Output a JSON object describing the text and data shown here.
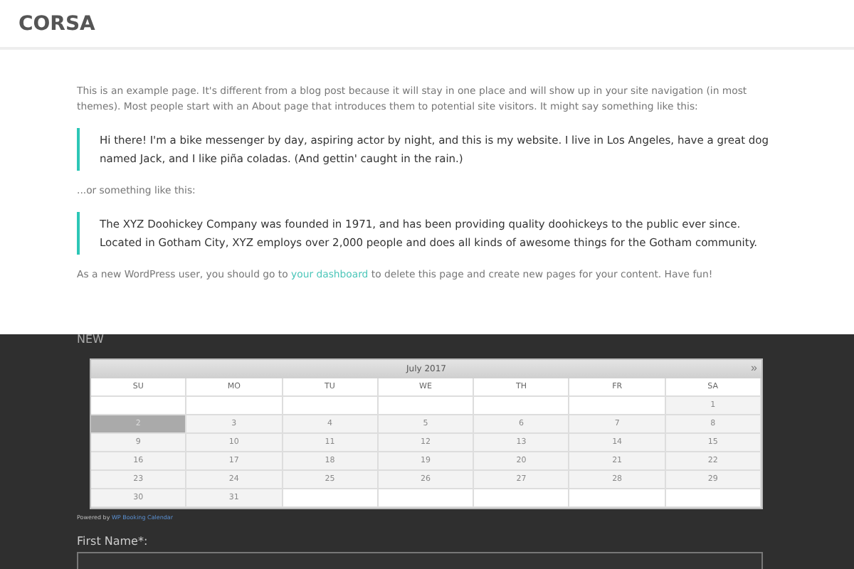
{
  "site": {
    "title": "CORSA"
  },
  "content": {
    "intro": "This is an example page. It's different from a blog post because it will stay in one place and will show up in your site navigation (in most themes). Most people start with an About page that introduces them to potential site visitors. It might say something like this:",
    "quote_1": "Hi there! I'm a bike messenger by day, aspiring actor by night, and this is my website. I live in Los Angeles, have a great dog named Jack, and I like piña coladas. (And gettin' caught in the rain.)",
    "middle": "...or something like this:",
    "quote_2": "The XYZ Doohickey Company was founded in 1971, and has been providing quality doohickeys to the public ever since. Located in Gotham City, XYZ employs over 2,000 people and does all kinds of awesome things for the Gotham community.",
    "outro_before": "As a new WordPress user, you should go to",
    "outro_link": "your dashboard",
    "outro_after": "to delete this page and create new pages for your content. Have fun!"
  },
  "booking": {
    "heading": "NEW",
    "calendar": {
      "month": "July 2017",
      "next": "»",
      "weekdays": [
        "SU",
        "MO",
        "TU",
        "WE",
        "TH",
        "FR",
        "SA"
      ],
      "weeks": [
        [
          {
            "kind": "blank"
          },
          {
            "kind": "blank"
          },
          {
            "kind": "blank"
          },
          {
            "kind": "blank"
          },
          {
            "kind": "blank"
          },
          {
            "kind": "blank"
          },
          {
            "kind": "day",
            "day": "1",
            "selected": false
          }
        ],
        [
          {
            "kind": "day",
            "day": "2",
            "selected": true
          },
          {
            "kind": "day",
            "day": "3",
            "selected": false
          },
          {
            "kind": "day",
            "day": "4",
            "selected": false
          },
          {
            "kind": "day",
            "day": "5",
            "selected": false
          },
          {
            "kind": "day",
            "day": "6",
            "selected": false
          },
          {
            "kind": "day",
            "day": "7",
            "selected": false
          },
          {
            "kind": "day",
            "day": "8",
            "selected": false
          }
        ],
        [
          {
            "kind": "day",
            "day": "9",
            "selected": false
          },
          {
            "kind": "day",
            "day": "10",
            "selected": false
          },
          {
            "kind": "day",
            "day": "11",
            "selected": false
          },
          {
            "kind": "day",
            "day": "12",
            "selected": false
          },
          {
            "kind": "day",
            "day": "13",
            "selected": false
          },
          {
            "kind": "day",
            "day": "14",
            "selected": false
          },
          {
            "kind": "day",
            "day": "15",
            "selected": false
          }
        ],
        [
          {
            "kind": "day",
            "day": "16",
            "selected": false
          },
          {
            "kind": "day",
            "day": "17",
            "selected": false
          },
          {
            "kind": "day",
            "day": "18",
            "selected": false
          },
          {
            "kind": "day",
            "day": "19",
            "selected": false
          },
          {
            "kind": "day",
            "day": "20",
            "selected": false
          },
          {
            "kind": "day",
            "day": "21",
            "selected": false
          },
          {
            "kind": "day",
            "day": "22",
            "selected": false
          }
        ],
        [
          {
            "kind": "day",
            "day": "23",
            "selected": false
          },
          {
            "kind": "day",
            "day": "24",
            "selected": false
          },
          {
            "kind": "day",
            "day": "25",
            "selected": false
          },
          {
            "kind": "day",
            "day": "26",
            "selected": false
          },
          {
            "kind": "day",
            "day": "27",
            "selected": false
          },
          {
            "kind": "day",
            "day": "28",
            "selected": false
          },
          {
            "kind": "day",
            "day": "29",
            "selected": false
          }
        ],
        [
          {
            "kind": "day",
            "day": "30",
            "selected": false
          },
          {
            "kind": "day",
            "day": "31",
            "selected": false
          },
          {
            "kind": "blank"
          },
          {
            "kind": "blank"
          },
          {
            "kind": "blank"
          },
          {
            "kind": "blank"
          },
          {
            "kind": "blank"
          }
        ]
      ]
    },
    "powered_by": "Powered by",
    "powered_link": "WP Booking Calendar",
    "field_label": "First Name*:"
  }
}
